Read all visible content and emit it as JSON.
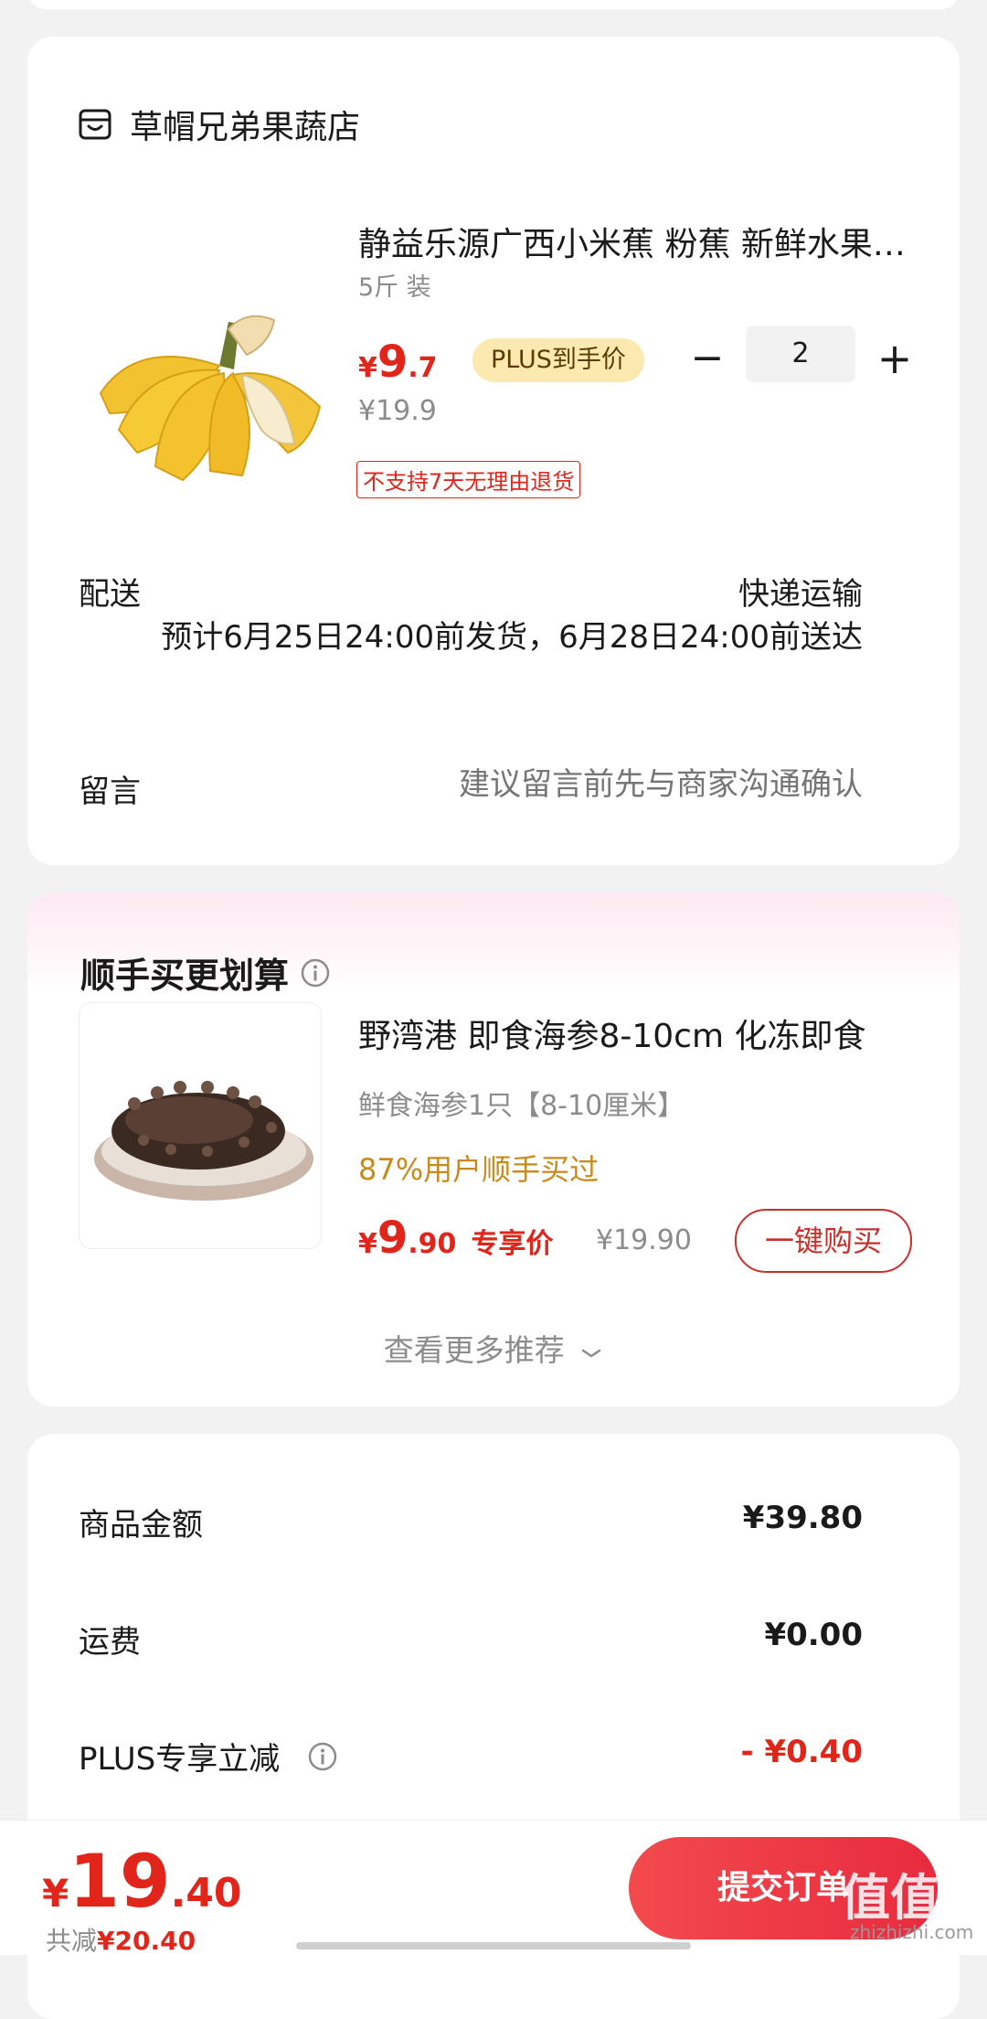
{
  "shop": {
    "name": "草帽兄弟果蔬店",
    "product": {
      "title": "静益乐源广西小米蕉 粉蕉 新鲜水果 香蕉",
      "spec": "5斤 装",
      "price_symbol": "¥",
      "price_int": "9",
      "price_dec": ".7",
      "badge": "PLUS到手价",
      "original_price": "¥19.9",
      "return_tag": "不支持7天无理由退货",
      "quantity": "2",
      "minus": "−",
      "plus": "+"
    },
    "shipping": {
      "label": "配送",
      "method": "快递运输",
      "detail": "预计6月25日24:00前发货，6月28日24:00前送达"
    },
    "note": {
      "label": "留言",
      "placeholder": "建议留言前先与商家沟通确认"
    }
  },
  "recommend": {
    "title": "顺手买更划算",
    "item": {
      "name": "野湾港 即食海参8-10cm 化冻即食",
      "spec": "鲜食海参1只【8-10厘米】",
      "social": "87%用户顺手买过",
      "price_symbol": "¥",
      "price_int": "9",
      "price_dec": ".90",
      "exclusive": "专享价",
      "original": "¥19.90",
      "button": "一键购买"
    },
    "more": "查看更多推荐"
  },
  "summary": {
    "goods_label": "商品金额",
    "goods_value": "¥39.80",
    "shipping_label": "运费",
    "shipping_value": "¥0.00",
    "plus_label": "PLUS专享立减",
    "plus_value": "- ¥0.40"
  },
  "bottom": {
    "price_symbol": "¥",
    "price_int": "19",
    "price_dec": ".40",
    "saved_label": "共减",
    "saved_value": "¥20.40",
    "submit": "提交订单"
  },
  "watermark": {
    "main": "值值值",
    "sub": "zhizhizhi.com"
  },
  "colors": {
    "accent": "#e1251b",
    "plus_badge": "#fce9b0",
    "social": "#c88a1a"
  }
}
